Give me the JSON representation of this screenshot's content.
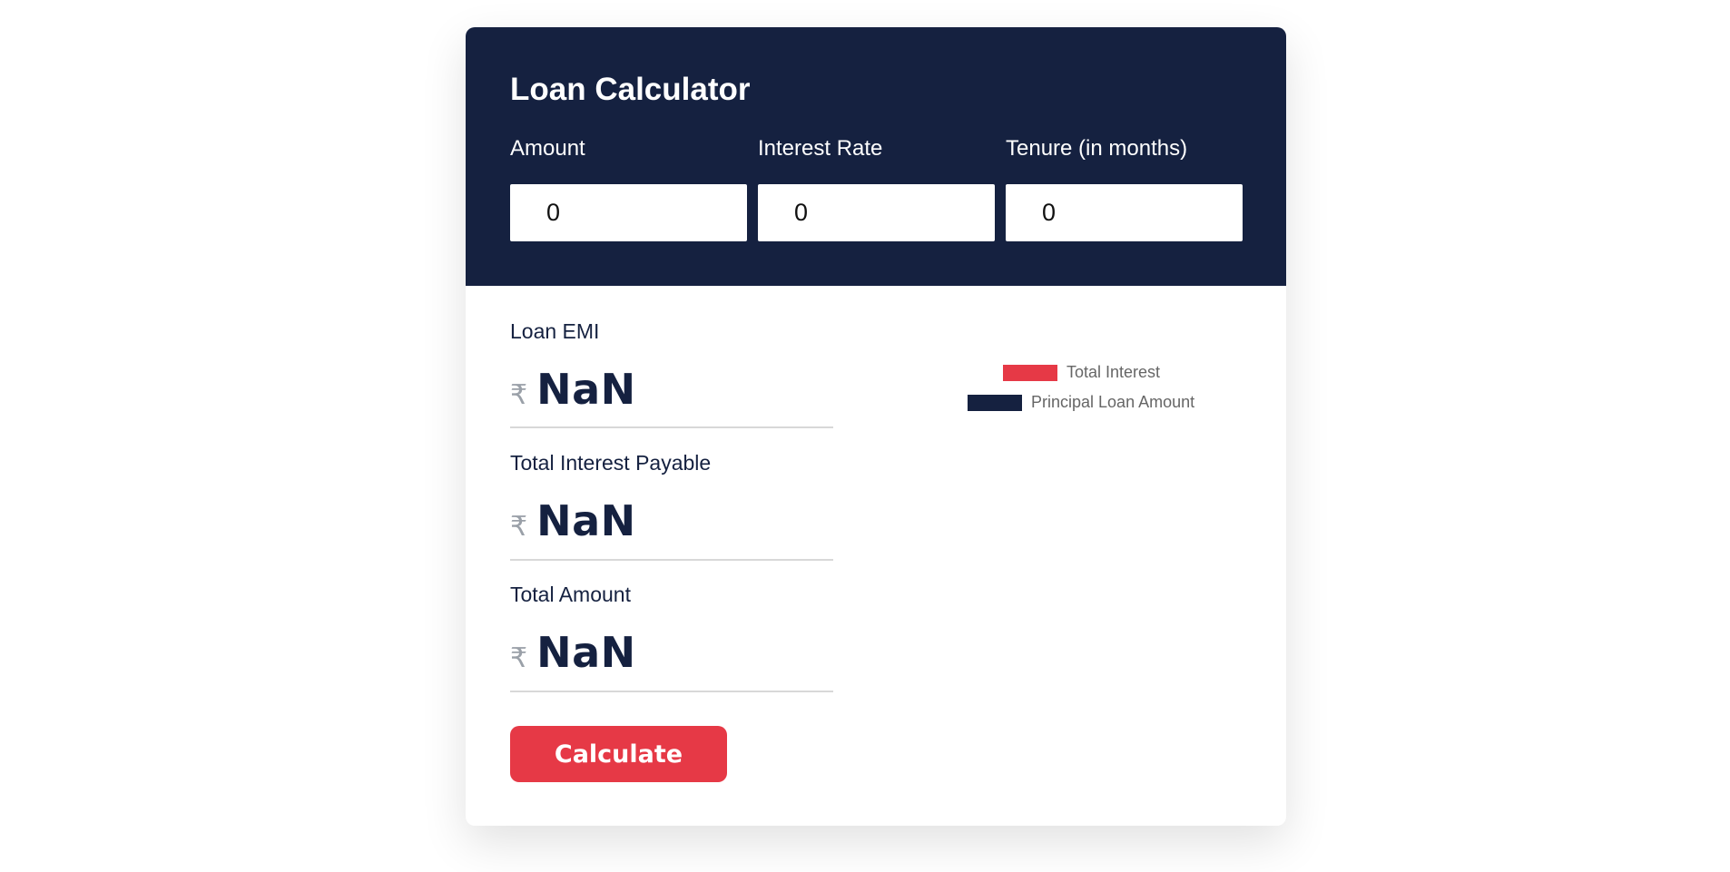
{
  "app": {
    "title": "Loan Calculator"
  },
  "inputs": {
    "amount": {
      "label": "Amount",
      "value": "0"
    },
    "interest_rate": {
      "label": "Interest Rate",
      "value": "0"
    },
    "tenure": {
      "label": "Tenure (in months)",
      "value": "0"
    }
  },
  "results": {
    "currency_symbol": "₹",
    "emi": {
      "label": "Loan EMI",
      "value": "NaN"
    },
    "total_interest": {
      "label": "Total Interest Payable",
      "value": "NaN"
    },
    "total_amount": {
      "label": "Total Amount",
      "value": "NaN"
    }
  },
  "actions": {
    "calculate_label": "Calculate"
  },
  "legend": {
    "items": [
      {
        "label": "Total Interest",
        "color": "#e63946"
      },
      {
        "label": "Principal Loan Amount",
        "color": "#152140"
      }
    ]
  },
  "colors": {
    "header_bg": "#152140",
    "accent": "#e63946"
  }
}
